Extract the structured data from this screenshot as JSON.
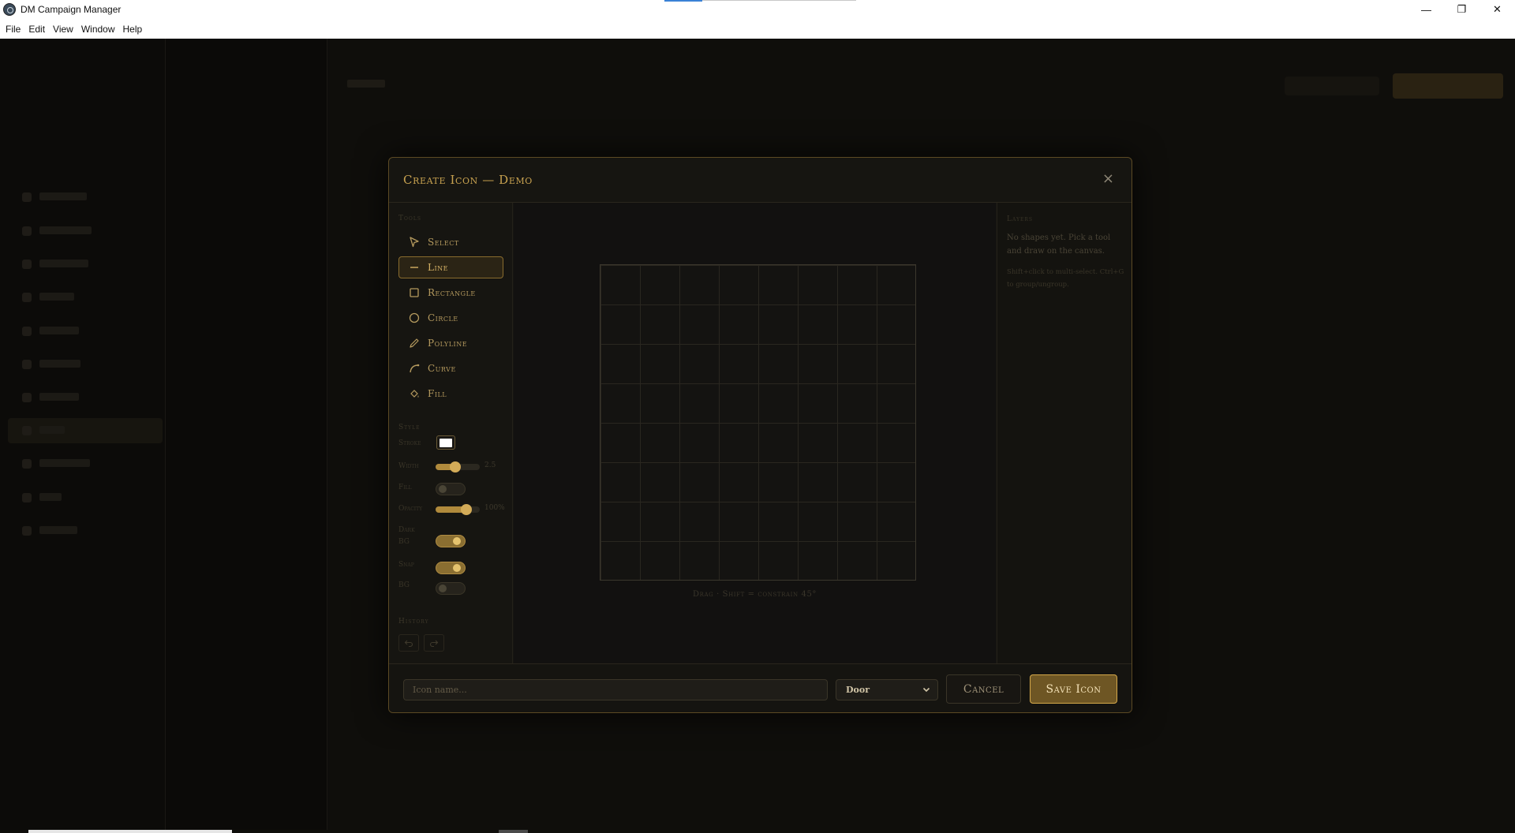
{
  "window": {
    "title": "DM Campaign Manager",
    "controls": {
      "minimize": "—",
      "maximize": "❐",
      "close": "✕"
    }
  },
  "menu": [
    {
      "label": "File"
    },
    {
      "label": "Edit"
    },
    {
      "label": "View"
    },
    {
      "label": "Window"
    },
    {
      "label": "Help"
    }
  ],
  "modal": {
    "title": "Create Icon — Demo",
    "close_label": "×",
    "tools_label": "Tools",
    "tools": [
      {
        "label": "Select",
        "icon": "cursor-icon",
        "active": false
      },
      {
        "label": "Line",
        "icon": "line-icon",
        "active": true
      },
      {
        "label": "Rectangle",
        "icon": "rectangle-icon",
        "active": false
      },
      {
        "label": "Circle",
        "icon": "circle-icon",
        "active": false
      },
      {
        "label": "Polyline",
        "icon": "pencil-icon",
        "active": false
      },
      {
        "label": "Curve",
        "icon": "curve-icon",
        "active": false
      },
      {
        "label": "Fill",
        "icon": "paint-bucket-icon",
        "active": false
      }
    ],
    "style_label": "Style",
    "style": {
      "stroke_label": "Stroke",
      "stroke_color": "#ffffff",
      "width_label": "Width",
      "width_value": "2.5",
      "width_fraction": 0.45,
      "fill_label": "Fill",
      "fill_on": false,
      "opacity_label": "Opacity",
      "opacity_value": "100%",
      "opacity_fraction": 0.7,
      "dark_bg_label_1": "Dark",
      "dark_bg_label_2": "BG",
      "dark_bg_on": true,
      "snap_label": "Snap",
      "snap_on": true,
      "bg_label": "BG",
      "bg_on": false
    },
    "history_label": "History",
    "canvas_hint": "Drag · Shift = constrain 45°",
    "layers_label": "Layers",
    "layers_empty": "No shapes yet. Pick a tool and draw on the canvas.",
    "layers_tip": "Shift+click to multi-select. Ctrl+G to group/ungroup.",
    "footer": {
      "name_placeholder": "Icon name...",
      "category_value": "Door",
      "cancel_label": "Cancel",
      "save_label": "Save Icon"
    }
  },
  "colors": {
    "accent_gold": "#c8a250",
    "modal_border": "#5c4a24"
  }
}
